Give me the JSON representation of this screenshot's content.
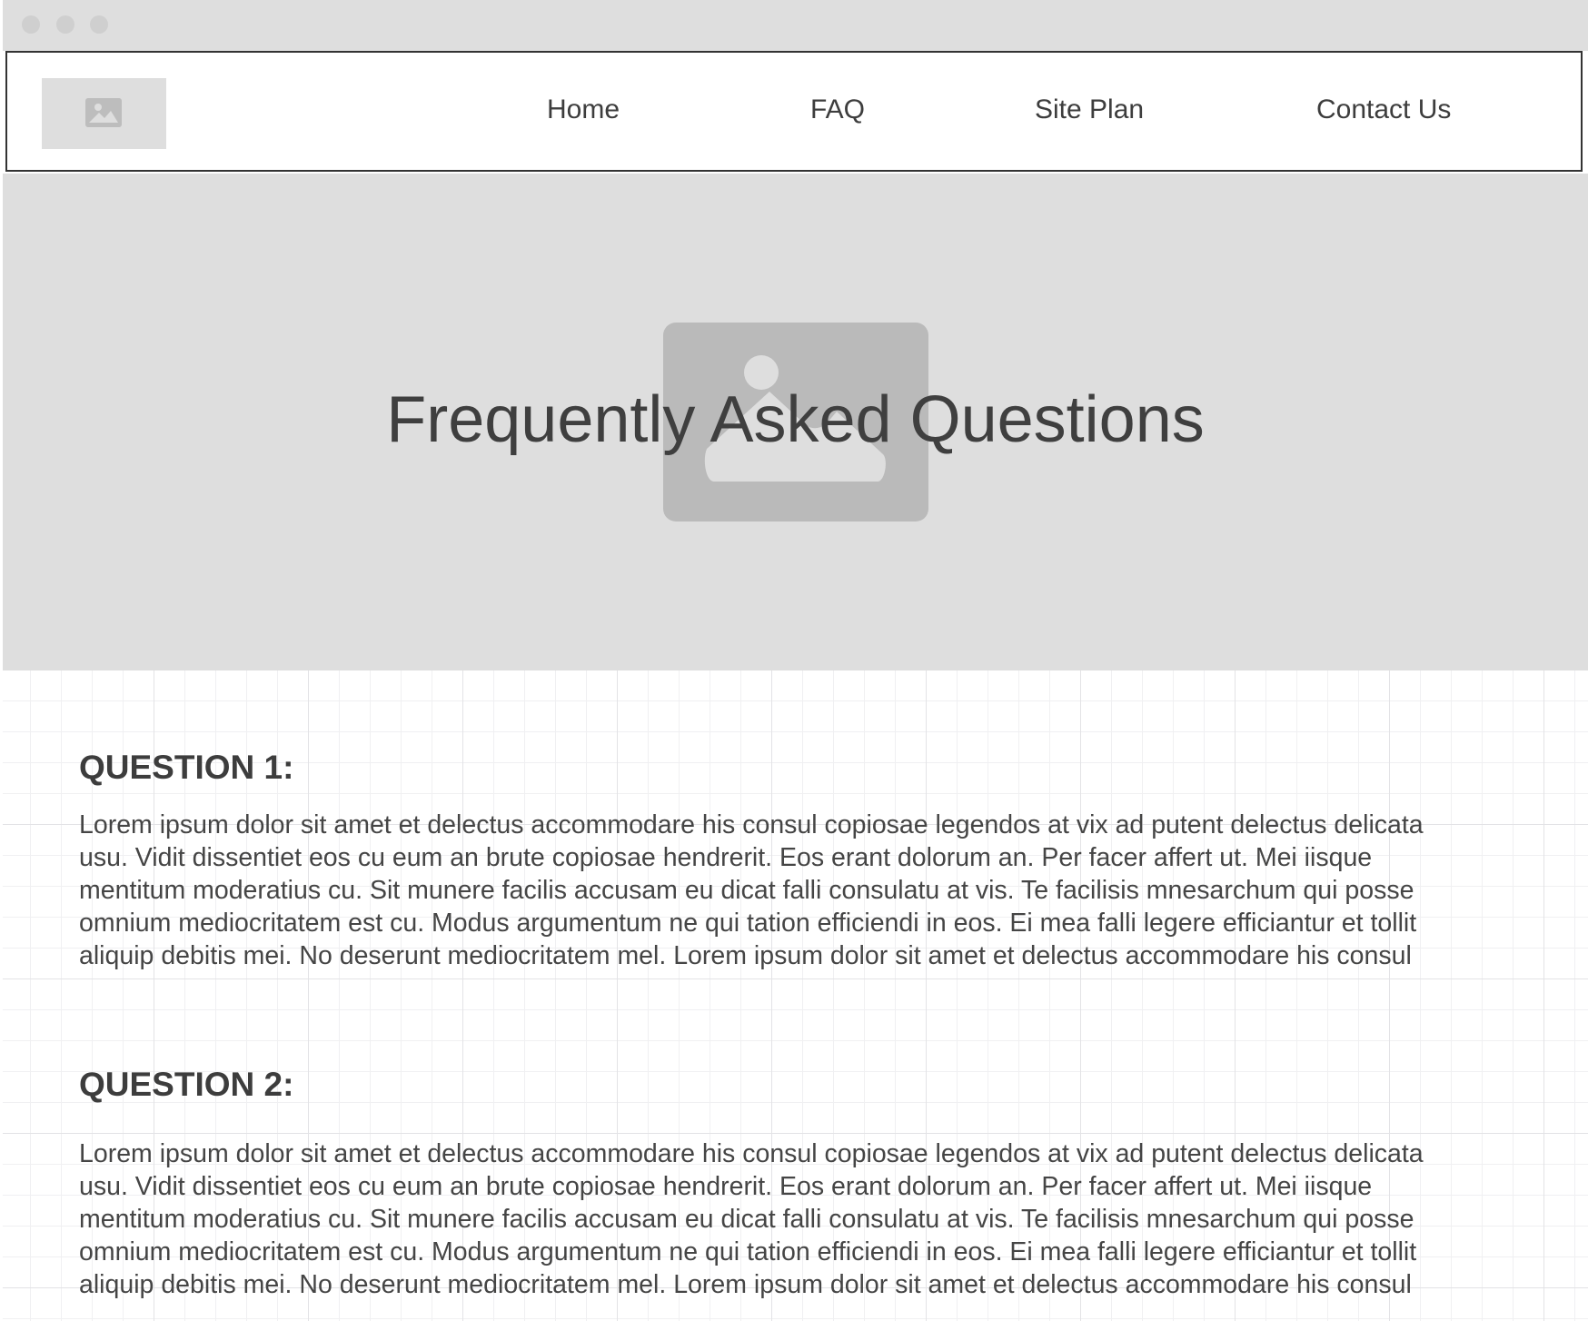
{
  "window": {
    "controls": [
      "window-dot",
      "window-dot",
      "window-dot"
    ]
  },
  "header": {
    "logo_icon": "image-placeholder-icon",
    "nav": [
      {
        "label": "Home"
      },
      {
        "label": "FAQ"
      },
      {
        "label": "Site Plan"
      },
      {
        "label": "Contact Us"
      }
    ]
  },
  "hero": {
    "image_icon": "image-placeholder-icon",
    "title": "Frequently Asked Questions"
  },
  "faq": [
    {
      "heading": "QUESTION 1:",
      "lines": [
        "Lorem ipsum dolor sit amet et delectus accommodare his consul copiosae legendos at vix ad putent delectus delicata",
        "usu. Vidit dissentiet eos cu eum an brute copiosae hendrerit. Eos erant dolorum an. Per facer affert ut. Mei iisque",
        "mentitum moderatius cu. Sit munere facilis accusam eu dicat falli consulatu at vis. Te facilisis mnesarchum qui posse",
        "omnium mediocritatem est cu. Modus argumentum ne qui tation efficiendi in eos. Ei mea falli legere efficiantur et tollit",
        "aliquip debitis mei. No deserunt mediocritatem mel. Lorem ipsum dolor sit amet et delectus accommodare his consul"
      ]
    },
    {
      "heading": "QUESTION 2:",
      "lines": [
        "Lorem ipsum dolor sit amet et delectus accommodare his consul copiosae legendos at vix ad putent delectus delicata",
        "usu. Vidit dissentiet eos cu eum an brute copiosae hendrerit. Eos erant dolorum an. Per facer affert ut. Mei iisque",
        "mentitum moderatius cu. Sit munere facilis accusam eu dicat falli consulatu at vis. Te facilisis mnesarchum qui posse",
        "omnium mediocritatem est cu. Modus argumentum ne qui tation efficiendi in eos. Ei mea falli legere efficiantur et tollit",
        "aliquip debitis mei. No deserunt mediocritatem mel. Lorem ipsum dolor sit amet et delectus accommodare his consul"
      ]
    }
  ]
}
